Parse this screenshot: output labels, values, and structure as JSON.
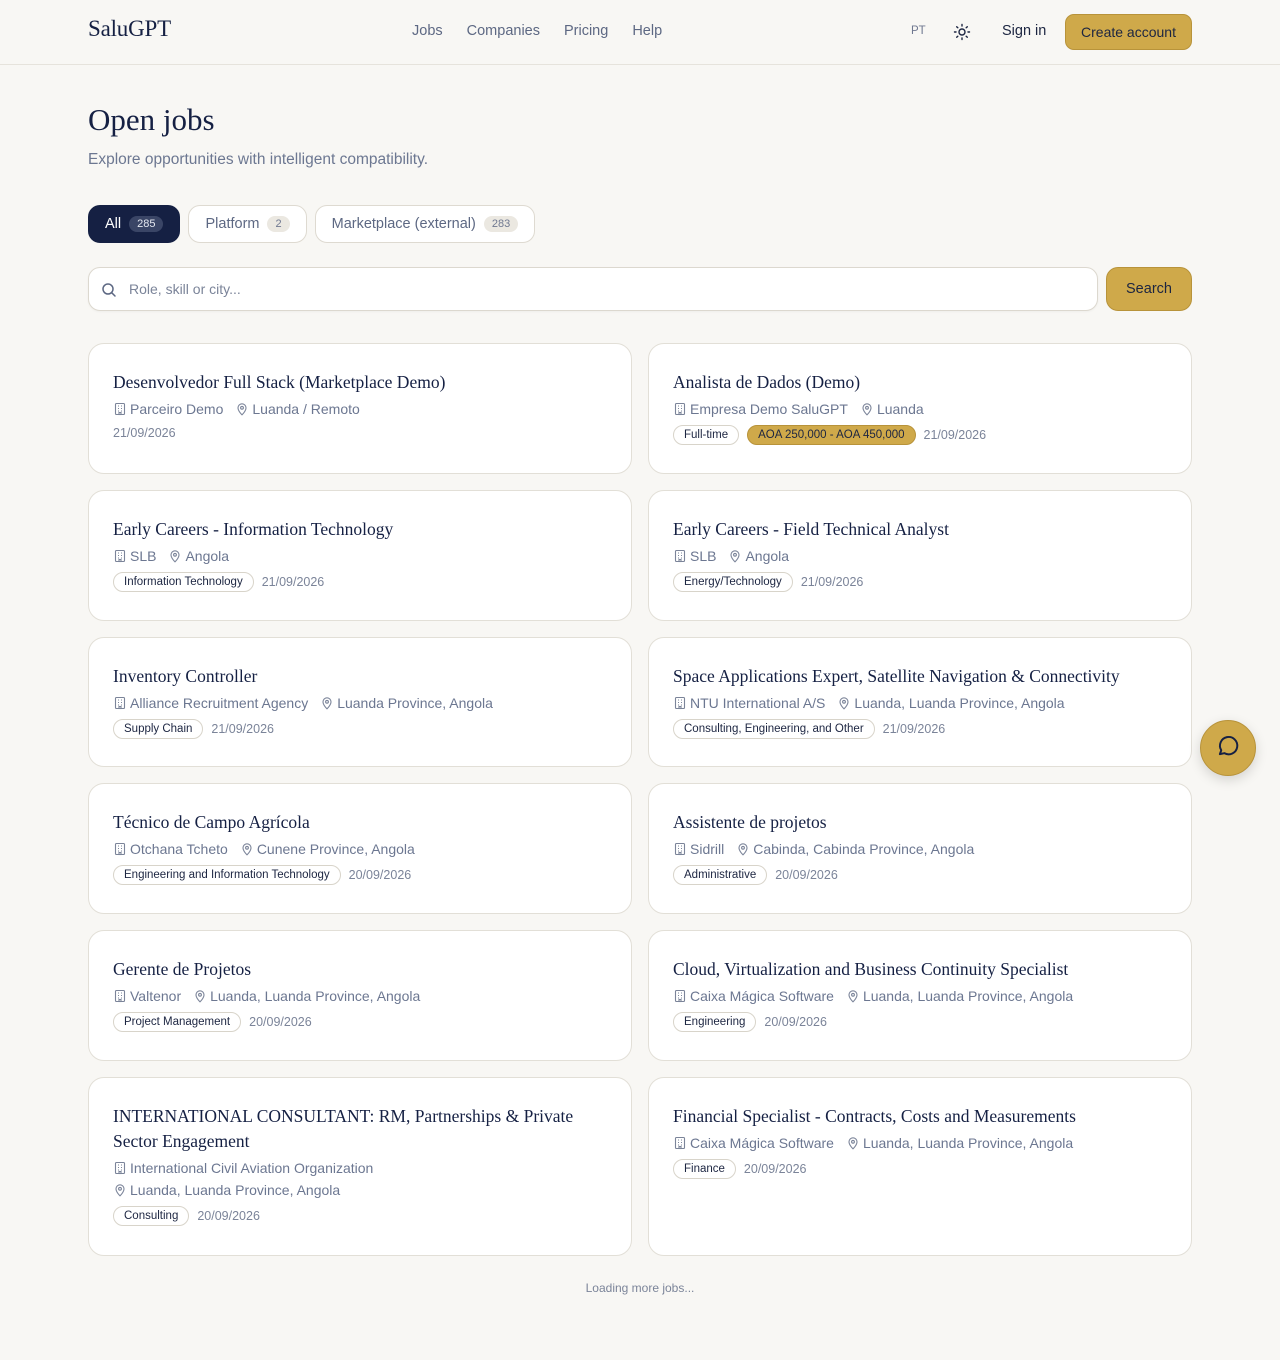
{
  "header": {
    "logo": "SaluGPT",
    "nav": [
      "Jobs",
      "Companies",
      "Pricing",
      "Help"
    ],
    "lang": "PT",
    "signin": "Sign in",
    "create_account": "Create account"
  },
  "page": {
    "title": "Open jobs",
    "subtitle": "Explore opportunities with intelligent compatibility."
  },
  "tabs": [
    {
      "label": "All",
      "count": "285",
      "active": true
    },
    {
      "label": "Platform",
      "count": "2",
      "active": false
    },
    {
      "label": "Marketplace (external)",
      "count": "283",
      "active": false
    }
  ],
  "search": {
    "placeholder": "Role, skill or city...",
    "button": "Search"
  },
  "jobs": [
    {
      "title": "Desenvolvedor Full Stack (Marketplace Demo)",
      "company": "Parceiro Demo",
      "location": "Luanda / Remoto",
      "tags": [],
      "date": "21/09/2026"
    },
    {
      "title": "Analista de Dados (Demo)",
      "company": "Empresa Demo SaluGPT",
      "location": "Luanda",
      "tags": [
        "Full-time"
      ],
      "salary": "AOA 250,000 - AOA 450,000",
      "date": "21/09/2026"
    },
    {
      "title": "Early Careers - Information Technology",
      "company": "SLB",
      "location": "Angola",
      "tags": [
        "Information Technology"
      ],
      "date": "21/09/2026"
    },
    {
      "title": "Early Careers - Field Technical Analyst",
      "company": "SLB",
      "location": "Angola",
      "tags": [
        "Energy/Technology"
      ],
      "date": "21/09/2026"
    },
    {
      "title": "Inventory Controller",
      "company": "Alliance Recruitment Agency",
      "location": "Luanda Province, Angola",
      "tags": [
        "Supply Chain"
      ],
      "date": "21/09/2026"
    },
    {
      "title": "Space Applications Expert, Satellite Navigation & Connectivity",
      "company": "NTU International A/S",
      "location": "Luanda, Luanda Province, Angola",
      "tags": [
        "Consulting, Engineering, and Other"
      ],
      "date": "21/09/2026"
    },
    {
      "title": "Técnico de Campo Agrícola",
      "company": "Otchana Tcheto",
      "location": "Cunene Province, Angola",
      "tags": [
        "Engineering and Information Technology"
      ],
      "date": "20/09/2026"
    },
    {
      "title": "Assistente de projetos",
      "company": "Sidrill",
      "location": "Cabinda, Cabinda Province, Angola",
      "tags": [
        "Administrative"
      ],
      "date": "20/09/2026"
    },
    {
      "title": "Gerente de Projetos",
      "company": "Valtenor",
      "location": "Luanda, Luanda Province, Angola",
      "tags": [
        "Project Management"
      ],
      "date": "20/09/2026"
    },
    {
      "title": "Cloud, Virtualization and Business Continuity Specialist",
      "company": "Caixa Mágica Software",
      "location": "Luanda, Luanda Province, Angola",
      "tags": [
        "Engineering"
      ],
      "date": "20/09/2026"
    },
    {
      "title": "INTERNATIONAL CONSULTANT: RM, Partnerships & Private Sector Engagement",
      "company": "International Civil Aviation Organization",
      "location": "Luanda, Luanda Province, Angola",
      "tags": [
        "Consulting"
      ],
      "date": "20/09/2026"
    },
    {
      "title": "Financial Specialist - Contracts, Costs and Measurements",
      "company": "Caixa Mágica Software",
      "location": "Luanda, Luanda Province, Angola",
      "tags": [
        "Finance"
      ],
      "date": "20/09/2026"
    }
  ],
  "footer": {
    "loading": "Loading more jobs..."
  },
  "colors": {
    "accent": "#cfa94a",
    "navy": "#152043",
    "background": "#f8f7f4"
  }
}
